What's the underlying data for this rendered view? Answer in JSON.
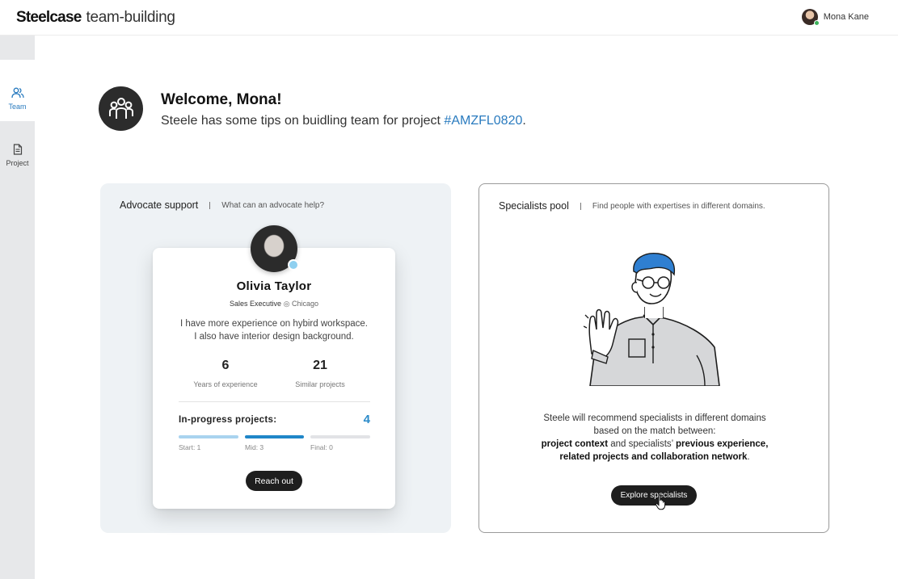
{
  "header": {
    "brand": "Steelcase",
    "product": "team-building",
    "user_name": "Mona Kane"
  },
  "sidebar": {
    "items": [
      {
        "label": "Team",
        "icon": "people-icon",
        "active": true
      },
      {
        "label": "Project",
        "icon": "document-icon",
        "active": false
      }
    ]
  },
  "welcome": {
    "title": "Welcome, Mona!",
    "subtitle_prefix": "Steele has some tips on buidling team for project ",
    "project_code": "#AMZFL0820",
    "subtitle_suffix": "."
  },
  "advocate": {
    "panel_title": "Advocate support",
    "panel_hint": "What can an advocate help?",
    "name": "Olivia Taylor",
    "role": "Sales Executive",
    "location_icon": "location-icon",
    "location": "Chicago",
    "bio_line1": "I have more experience on hybird workspace.",
    "bio_line2": "I also have interior design background.",
    "stats": [
      {
        "value": "6",
        "label": "Years of experience"
      },
      {
        "value": "21",
        "label": "Similar projects"
      }
    ],
    "in_progress_label": "In-progress projects:",
    "in_progress_count": "4",
    "stages": [
      {
        "label": "Start: 1",
        "color": "#a9d3ef"
      },
      {
        "label": "Mid: 3",
        "color": "#1f86c8"
      },
      {
        "label": "Final: 0",
        "color": "#e2e3e6"
      }
    ],
    "reach_out_label": "Reach out"
  },
  "specialists": {
    "panel_title": "Specialists pool",
    "panel_hint": "Find people with expertises in different domains.",
    "desc_line1": "Steele will recommend specialists in different domains",
    "desc_line2": "based on the match between:",
    "desc_b1": "project context",
    "desc_mid": " and specialists’ ",
    "desc_b2": "previous experience,",
    "desc_b3": "related projects and collaboration network",
    "desc_end": ".",
    "explore_label": "Explore specialists"
  },
  "colors": {
    "accent": "#2a7bbf",
    "button_dark": "#1e1e1e",
    "panel_bg": "#eef2f5",
    "sidebar_bg": "#e7e8ea"
  }
}
